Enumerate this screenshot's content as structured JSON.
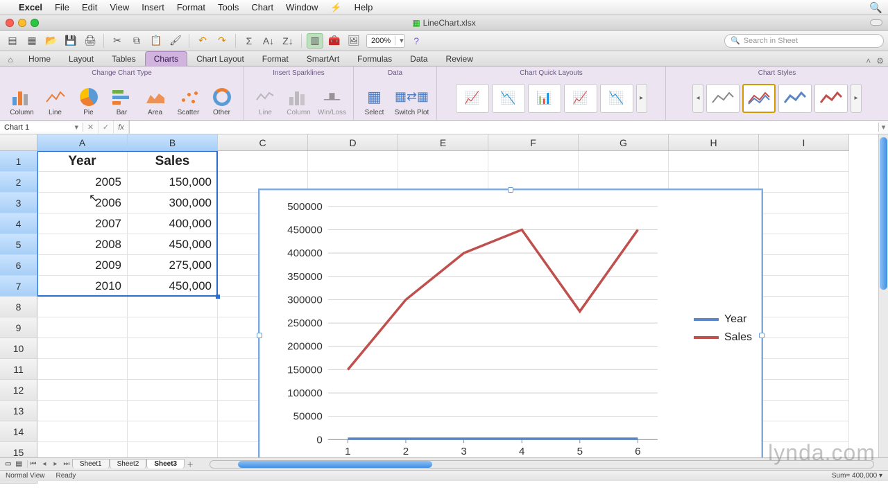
{
  "menubar": {
    "app": "Excel",
    "items": [
      "File",
      "Edit",
      "View",
      "Insert",
      "Format",
      "Tools",
      "Chart",
      "Window",
      "Help"
    ]
  },
  "window": {
    "filename": "LineChart.xlsx"
  },
  "quickbar": {
    "zoom": "200%",
    "search_placeholder": "Search in Sheet"
  },
  "ribbon_tabs": [
    "Home",
    "Layout",
    "Tables",
    "Charts",
    "Chart Layout",
    "Format",
    "SmartArt",
    "Formulas",
    "Data",
    "Review"
  ],
  "ribbon_active": "Charts",
  "ribbon": {
    "group_chart_type": "Change Chart Type",
    "group_sparklines": "Insert Sparklines",
    "group_data": "Data",
    "group_layouts": "Chart Quick Layouts",
    "group_styles": "Chart Styles",
    "types": {
      "column": "Column",
      "line": "Line",
      "pie": "Pie",
      "bar": "Bar",
      "area": "Area",
      "scatter": "Scatter",
      "other": "Other"
    },
    "spark": {
      "line": "Line",
      "column": "Column",
      "winloss": "Win/Loss"
    },
    "data": {
      "select": "Select",
      "switch": "Switch Plot"
    }
  },
  "namebox": "Chart 1",
  "columns": [
    "A",
    "B",
    "C",
    "D",
    "E",
    "F",
    "G",
    "H",
    "I"
  ],
  "rows": 16,
  "cells": {
    "headers": {
      "A": "Year",
      "B": "Sales"
    },
    "data": [
      {
        "year": "2005",
        "sales": "150,000"
      },
      {
        "year": "2006",
        "sales": "300,000"
      },
      {
        "year": "2007",
        "sales": "400,000"
      },
      {
        "year": "2008",
        "sales": "450,000"
      },
      {
        "year": "2009",
        "sales": "275,000"
      },
      {
        "year": "2010",
        "sales": "450,000"
      }
    ]
  },
  "chart_data": {
    "type": "line",
    "x": [
      1,
      2,
      3,
      4,
      5,
      6
    ],
    "series": [
      {
        "name": "Year",
        "values": [
          2005,
          2006,
          2007,
          2008,
          2009,
          2010
        ],
        "color": "#5b86c5"
      },
      {
        "name": "Sales",
        "values": [
          150000,
          300000,
          400000,
          450000,
          275000,
          450000
        ],
        "color": "#c0504d"
      }
    ],
    "ylim": [
      0,
      500000
    ],
    "ytick": 50000,
    "xlabel": "",
    "ylabel": "",
    "title": "",
    "legend": [
      "Year",
      "Sales"
    ]
  },
  "yticks": [
    "500000",
    "450000",
    "400000",
    "350000",
    "300000",
    "250000",
    "200000",
    "150000",
    "100000",
    "50000",
    "0"
  ],
  "xticks": [
    "1",
    "2",
    "3",
    "4",
    "5",
    "6"
  ],
  "sheets": [
    "Sheet1",
    "Sheet2",
    "Sheet3"
  ],
  "active_sheet": "Sheet3",
  "status": {
    "view": "Normal View",
    "ready": "Ready",
    "sum_label": "Sum=",
    "sum_value": "400,000"
  },
  "watermark": "lynda.com"
}
